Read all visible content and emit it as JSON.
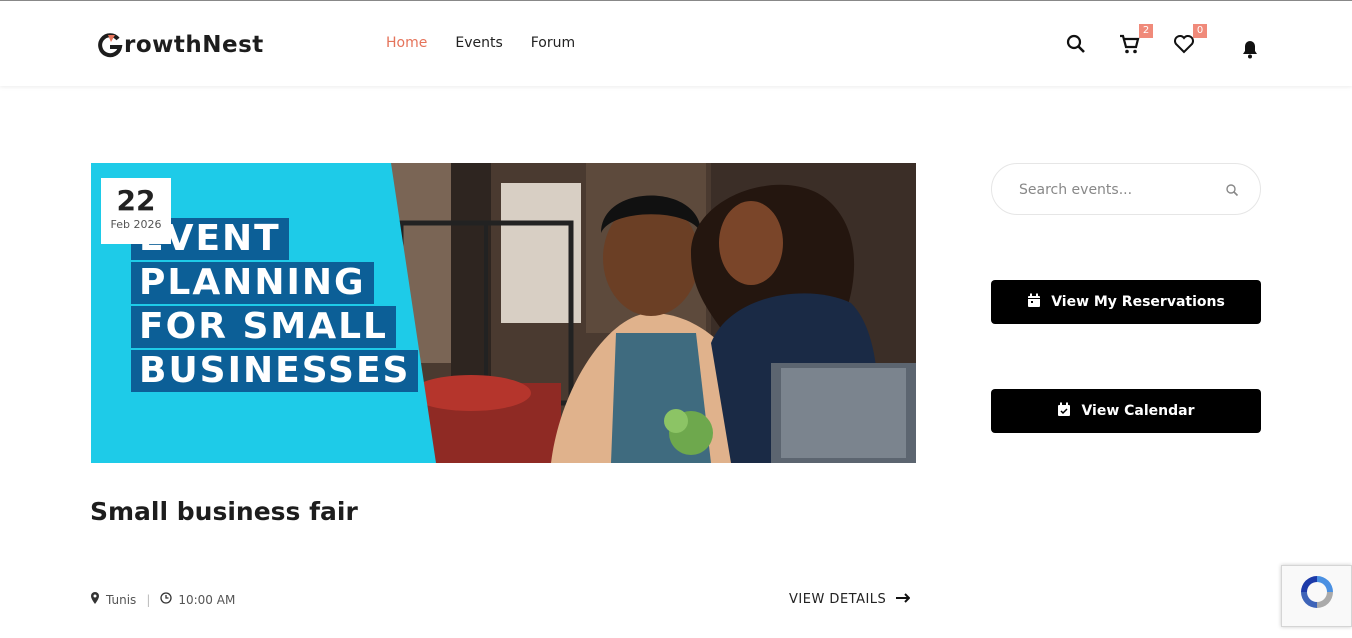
{
  "header": {
    "logo_text": "rowthNest",
    "nav": [
      {
        "label": "Home",
        "active": true
      },
      {
        "label": "Events",
        "active": false
      },
      {
        "label": "Forum",
        "active": false
      }
    ],
    "cart_count": "2",
    "wishlist_count": "0",
    "icons": [
      "search-icon",
      "cart-icon",
      "heart-icon",
      "bell-icon"
    ]
  },
  "event": {
    "date_day": "22",
    "date_month": "Feb 2026",
    "banner_lines": [
      "EVENT",
      "PLANNING",
      "FOR SMALL",
      "BUSINESSES"
    ],
    "title": "Small business fair",
    "location": "Tunis",
    "time": "10:00 AM",
    "details_label": "VIEW DETAILS"
  },
  "sidebar": {
    "search_placeholder": "Search events...",
    "reservations_label": "View My Reservations",
    "calendar_label": "View Calendar"
  },
  "colors": {
    "accent": "#e5735a",
    "banner_cyan": "#1ecbe8",
    "banner_blue": "#0c5f97",
    "button_black": "#000000"
  }
}
